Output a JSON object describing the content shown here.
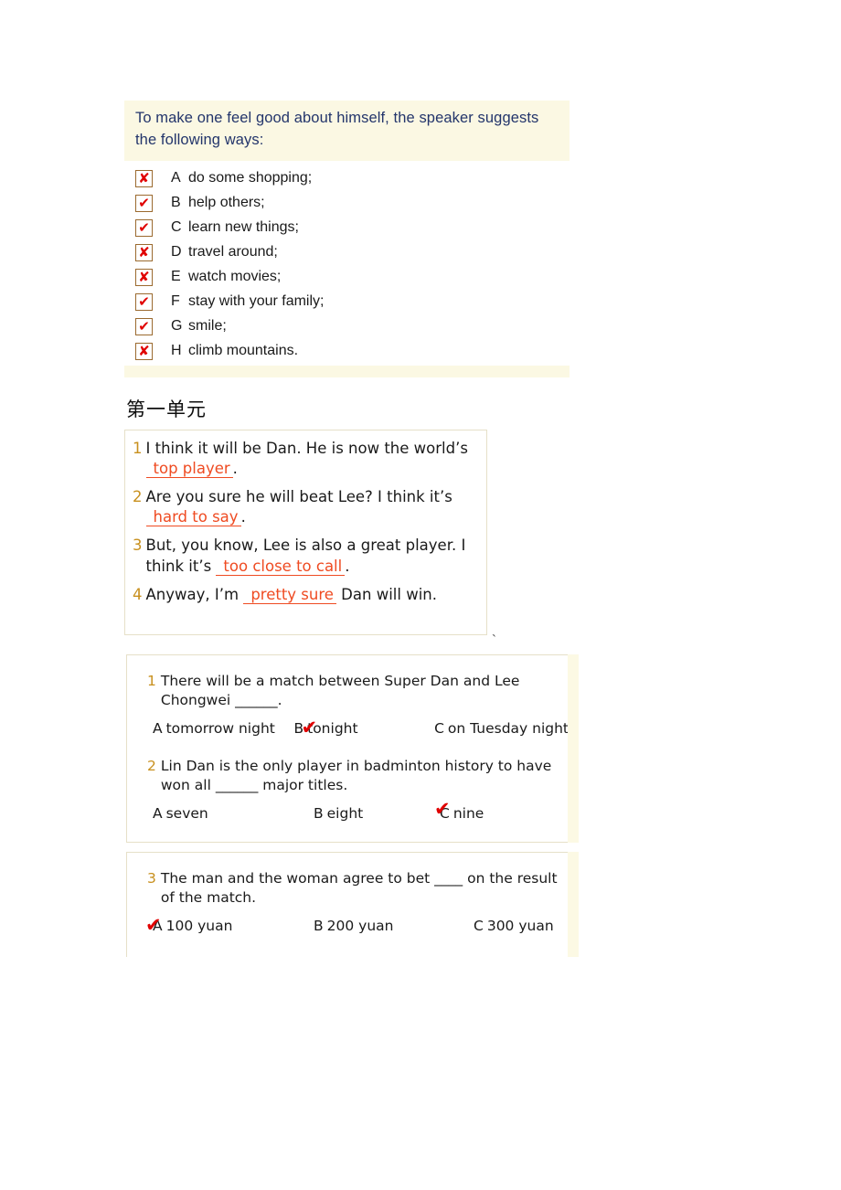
{
  "section1": {
    "header": "To make one feel good about himself, the speaker suggests the following ways:",
    "header_color": "#23356b",
    "header_bg": "#fbf8e3",
    "items": [
      {
        "mark": "✘",
        "state": "wrong",
        "letter": "A",
        "text": "do some shopping;"
      },
      {
        "mark": "✔",
        "state": "right",
        "letter": "B",
        "text": "help others;"
      },
      {
        "mark": "✔",
        "state": "right",
        "letter": "C",
        "text": "learn new things;"
      },
      {
        "mark": "✘",
        "state": "wrong",
        "letter": "D",
        "text": "travel around;"
      },
      {
        "mark": "✘",
        "state": "wrong",
        "letter": "E",
        "text": "watch movies;"
      },
      {
        "mark": "✔",
        "state": "right",
        "letter": "F",
        "text": "stay with your family;"
      },
      {
        "mark": "✔",
        "state": "right",
        "letter": "G",
        "text": "smile;"
      },
      {
        "mark": "✘",
        "state": "wrong",
        "letter": "H",
        "text": "climb mountains."
      }
    ]
  },
  "heading": {
    "text": "第一单元"
  },
  "dialogue": {
    "lines": [
      {
        "num": "1",
        "before": "I think it will be Dan. He is now the world’s ",
        "answer": "top player",
        "after": "."
      },
      {
        "num": "2",
        "before": "Are you sure he will beat Lee? I think it’s ",
        "answer": "hard to say",
        "after": "."
      },
      {
        "num": "3",
        "before": "But, you know, Lee is also a great player. I think it’s ",
        "answer": "too close to call",
        "after": "."
      },
      {
        "num": "4",
        "before": "Anyway, I’m ",
        "answer": "pretty sure",
        "after": " Dan will win."
      }
    ],
    "stray_mark": "`",
    "answer_color": "#ef4b22",
    "number_color": "#c8901e"
  },
  "mcq_box_1": {
    "questions": [
      {
        "num": "1",
        "text": "There will be a match between Super Dan and Lee Chongwei ______.",
        "options": [
          {
            "label": "A",
            "text": "tomorrow night",
            "checked": false
          },
          {
            "label": "B",
            "text": "tonight",
            "checked": true
          },
          {
            "label": "C",
            "text": "on Tuesday night",
            "checked": false
          }
        ]
      },
      {
        "num": "2",
        "text": "Lin Dan is the only player in badminton history to have won all ______ major titles.",
        "options": [
          {
            "label": "A",
            "text": "seven",
            "checked": false
          },
          {
            "label": "B",
            "text": "eight",
            "checked": false
          },
          {
            "label": "C",
            "text": "nine",
            "checked": true
          }
        ]
      }
    ]
  },
  "mcq_box_2": {
    "questions": [
      {
        "num": "3",
        "text": "The man and the woman agree to bet ____ on the result of the match.",
        "options": [
          {
            "label": "A",
            "text": "100 yuan",
            "checked": true
          },
          {
            "label": "B",
            "text": "200 yuan",
            "checked": false
          },
          {
            "label": "C",
            "text": "300 yuan",
            "checked": false
          }
        ]
      }
    ]
  },
  "check_glyph": "✔"
}
